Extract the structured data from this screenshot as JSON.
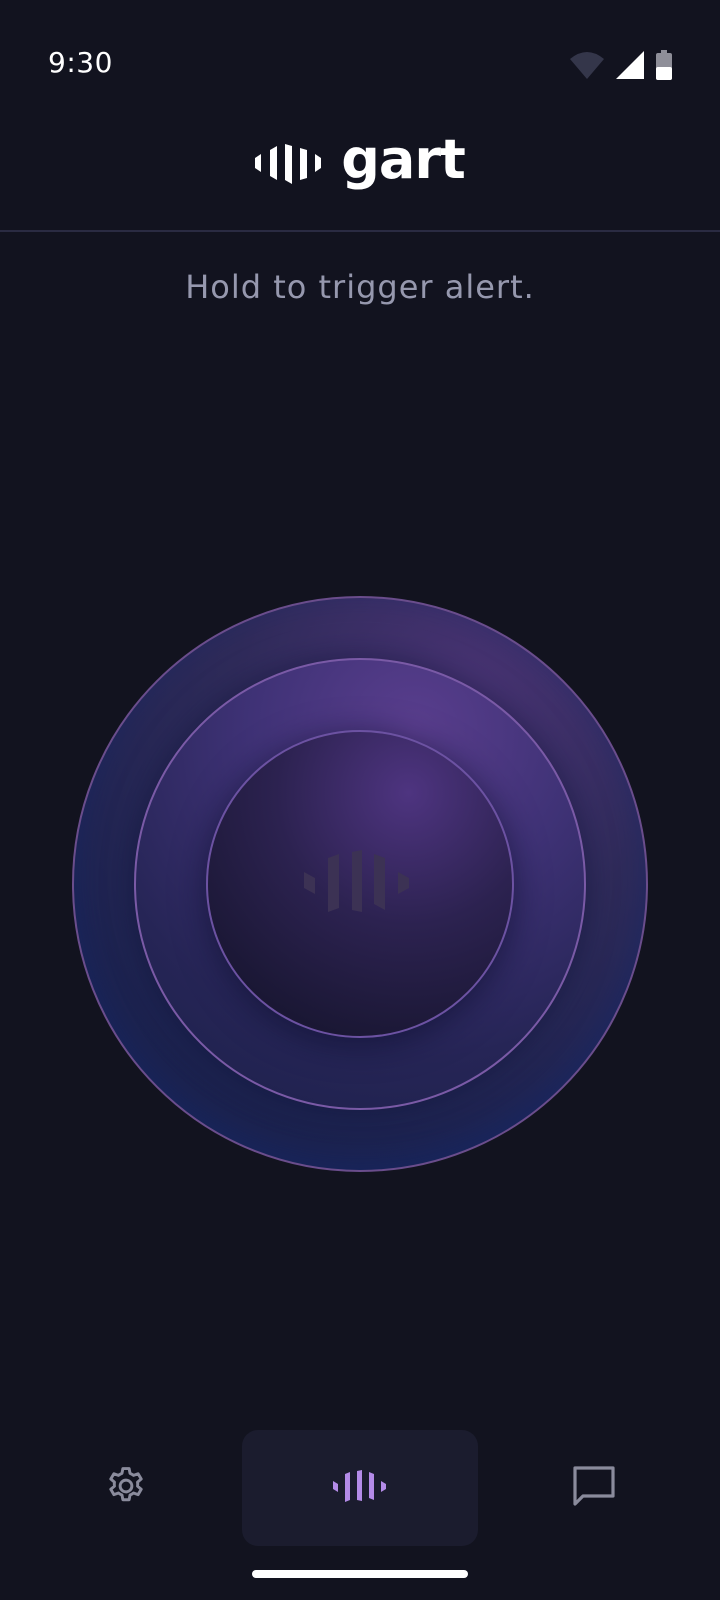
{
  "status_bar": {
    "time": "9:30",
    "icons": [
      "wifi-icon",
      "signal-icon",
      "battery-icon"
    ]
  },
  "header": {
    "brand_name": "gart",
    "logo_icon": "soundwave-logo-icon"
  },
  "main": {
    "instruction": "Hold to trigger alert.",
    "alert_button_icon": "soundwave-logo-icon"
  },
  "bottom_nav": {
    "items": [
      {
        "icon": "gear-icon",
        "active": false
      },
      {
        "icon": "soundwave-icon",
        "active": true
      },
      {
        "icon": "message-icon",
        "active": false
      }
    ]
  },
  "colors": {
    "background": "#12131f",
    "accent": "#b48be8",
    "nav_active_bg": "#1b1c2e",
    "muted_text": "#9698ae",
    "icon_gray": "#8a8b9c"
  }
}
